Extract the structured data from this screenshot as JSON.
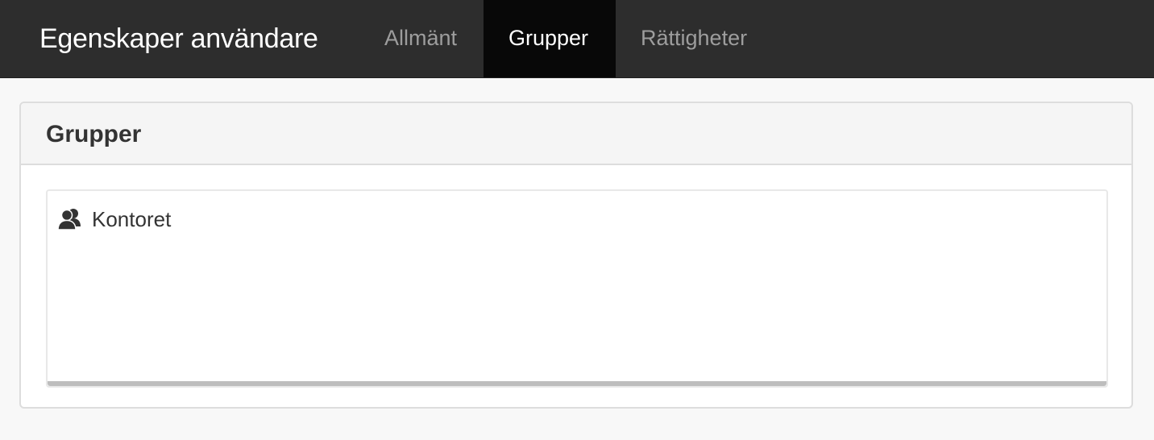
{
  "navbar": {
    "brand": "Egenskaper användare",
    "tabs": [
      {
        "label": "Allmänt",
        "active": false
      },
      {
        "label": "Grupper",
        "active": true
      },
      {
        "label": "Rättigheter",
        "active": false
      }
    ]
  },
  "panel": {
    "title": "Grupper",
    "groups": [
      {
        "label": "Kontoret",
        "icon": "users-icon"
      }
    ]
  },
  "colors": {
    "navbar_bg": "#2d2d2d",
    "active_tab_bg": "#080808",
    "inactive_tab_text": "#9d9d9d",
    "panel_heading_bg": "#f5f5f5"
  }
}
